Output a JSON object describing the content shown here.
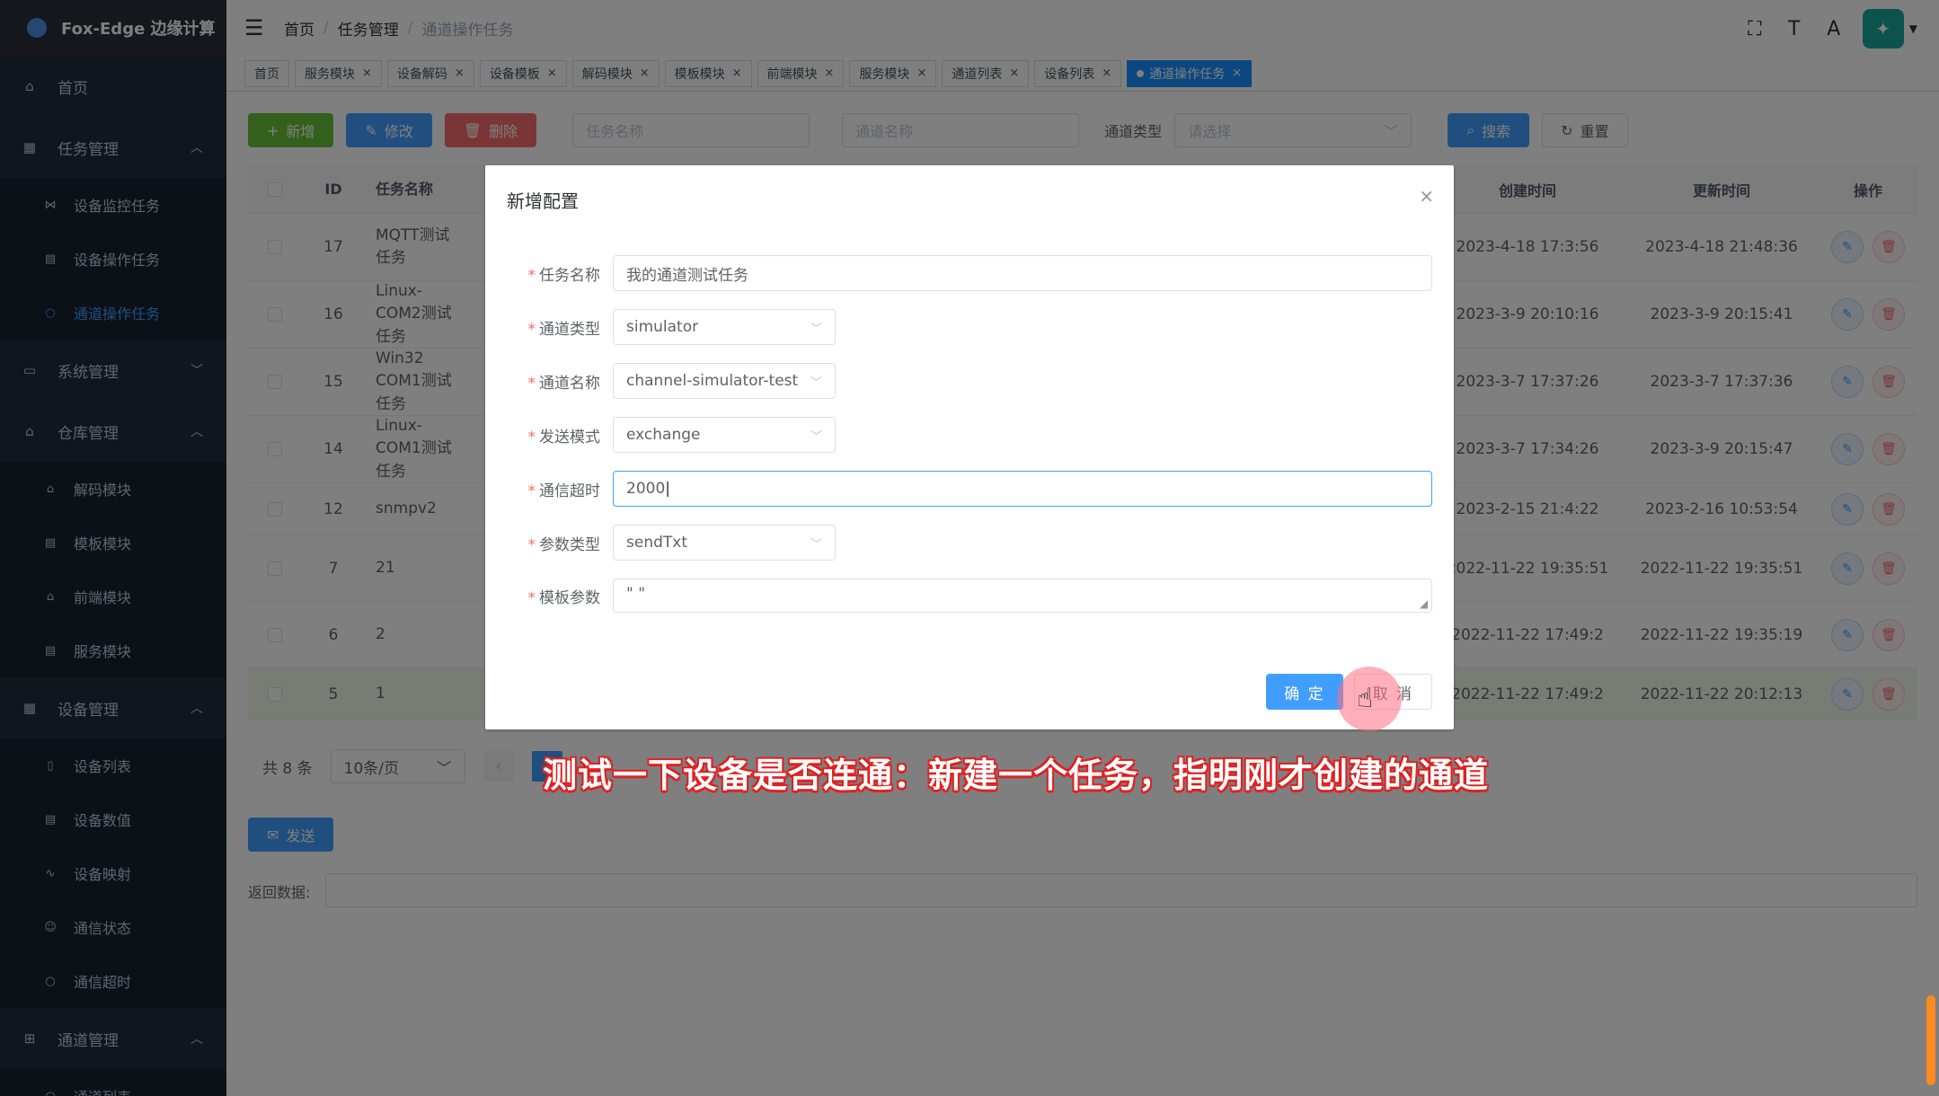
{
  "app": {
    "title": "Fox-Edge 边缘计算"
  },
  "sidebar": {
    "items": [
      {
        "label": "首页",
        "icon": "home-icon",
        "type": "top"
      },
      {
        "label": "任务管理",
        "icon": "dashboard-icon",
        "type": "group",
        "expanded": true,
        "children": [
          {
            "label": "设备监控任务",
            "icon": "share-icon"
          },
          {
            "label": "设备操作任务",
            "icon": "form-icon"
          },
          {
            "label": "通道操作任务",
            "icon": "circle-icon",
            "active": true
          }
        ]
      },
      {
        "label": "系统管理",
        "icon": "monitor-icon",
        "type": "group",
        "expanded": false
      },
      {
        "label": "仓库管理",
        "icon": "warehouse-icon",
        "type": "group",
        "expanded": true,
        "children": [
          {
            "label": "解码模块",
            "icon": "build-icon"
          },
          {
            "label": "模板模块",
            "icon": "doc-icon"
          },
          {
            "label": "前端模块",
            "icon": "build-icon"
          },
          {
            "label": "服务模块",
            "icon": "doc-icon"
          }
        ]
      },
      {
        "label": "设备管理",
        "icon": "table-icon",
        "type": "group",
        "expanded": true,
        "children": [
          {
            "label": "设备列表",
            "icon": "device-icon"
          },
          {
            "label": "设备数值",
            "icon": "data-icon"
          },
          {
            "label": "设备映射",
            "icon": "map-icon"
          },
          {
            "label": "通信状态",
            "icon": "status-icon"
          },
          {
            "label": "通信超时",
            "icon": "timeout-icon"
          }
        ]
      },
      {
        "label": "通道管理",
        "icon": "channel-icon",
        "type": "group",
        "expanded": true,
        "children": [
          {
            "label": "通道列表",
            "icon": "circle-icon"
          }
        ]
      }
    ]
  },
  "header": {
    "breadcrumb": [
      "首页",
      "任务管理",
      "通道操作任务"
    ]
  },
  "tags": [
    {
      "label": "首页",
      "closable": false
    },
    {
      "label": "服务模块",
      "closable": true
    },
    {
      "label": "设备解码",
      "closable": true
    },
    {
      "label": "设备模板",
      "closable": true
    },
    {
      "label": "解码模块",
      "closable": true
    },
    {
      "label": "模板模块",
      "closable": true
    },
    {
      "label": "前端模块",
      "closable": true
    },
    {
      "label": "服务模块",
      "closable": true
    },
    {
      "label": "通道列表",
      "closable": true
    },
    {
      "label": "设备列表",
      "closable": true
    },
    {
      "label": "通道操作任务",
      "closable": true,
      "active": true
    }
  ],
  "toolbar": {
    "add": "新增",
    "edit": "修改",
    "delete": "删除",
    "task_name_placeholder": "任务名称",
    "channel_name_placeholder": "通道名称",
    "channel_type_label": "通道类型",
    "channel_type_placeholder": "请选择",
    "search": "搜索",
    "reset": "重置"
  },
  "table": {
    "columns": {
      "id": "ID",
      "name": "任务名称",
      "created": "创建时间",
      "updated": "更新时间",
      "ops": "操作"
    },
    "rows": [
      {
        "id": "17",
        "name": "MQTT测试任务",
        "created": "2023-4-18 17:3:56",
        "updated": "2023-4-18 21:48:36"
      },
      {
        "id": "16",
        "name": "Linux-COM2测试任务",
        "created": "2023-3-9 20:10:16",
        "updated": "2023-3-9 20:15:41"
      },
      {
        "id": "15",
        "name": "Win32 COM1测试任务",
        "created": "2023-3-7 17:37:26",
        "updated": "2023-3-7 17:37:36"
      },
      {
        "id": "14",
        "name": "Linux-COM1测试任务",
        "created": "2023-3-7 17:34:26",
        "updated": "2023-3-9 20:15:47"
      },
      {
        "id": "12",
        "name": "snmpv2",
        "created": "2023-2-15 21:4:22",
        "updated": "2023-2-16 10:53:54"
      },
      {
        "id": "7",
        "name": "21",
        "created": "2022-11-22 19:35:51",
        "updated": "2022-11-22 19:35:51"
      },
      {
        "id": "6",
        "name": "2",
        "created": "2022-11-22 17:49:2",
        "updated": "2022-11-22 19:35:19"
      },
      {
        "id": "5",
        "name": "1",
        "created": "2022-11-22 17:49:2",
        "updated": "2022-11-22 20:12:13",
        "highlight": true
      }
    ]
  },
  "pager": {
    "total": "共 8 条",
    "page_size": "10条/页"
  },
  "send": {
    "label": "发送",
    "return_label": "返回数据:"
  },
  "dialog": {
    "title": "新增配置",
    "fields": [
      {
        "label": "任务名称",
        "value": "我的通道测试任务",
        "kind": "input"
      },
      {
        "label": "通道类型",
        "value": "simulator",
        "kind": "select"
      },
      {
        "label": "通道名称",
        "value": "channel-simulator-test",
        "kind": "select"
      },
      {
        "label": "发送模式",
        "value": "exchange",
        "kind": "select"
      },
      {
        "label": "通信超时",
        "value": "2000",
        "kind": "input",
        "focused": true
      },
      {
        "label": "参数类型",
        "value": "sendTxt",
        "kind": "select"
      },
      {
        "label": "模板参数",
        "value": "\"   \"",
        "kind": "textarea"
      }
    ],
    "ok": "确 定",
    "cancel": "取 消"
  },
  "caption": "测试一下设备是否连通：新建一个任务，指明刚才创建的通道"
}
